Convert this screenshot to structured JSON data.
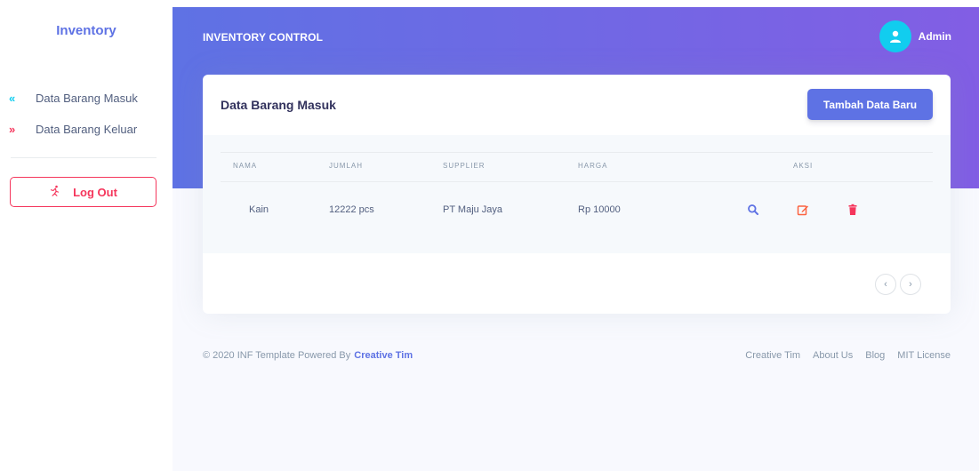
{
  "sidebar": {
    "brand": "Inventory",
    "items": [
      {
        "label": "Data Barang Masuk",
        "icon": "double-chevron-left-icon",
        "glyph": "«",
        "color": "#11cdef"
      },
      {
        "label": "Data Barang Keluar",
        "icon": "double-chevron-right-icon",
        "glyph": "»",
        "color": "#f5365c"
      }
    ],
    "logout_label": "Log Out"
  },
  "header": {
    "title": "INVENTORY CONTROL",
    "user_name": "Admin"
  },
  "card": {
    "title": "Data Barang Masuk",
    "add_button": "Tambah Data Baru",
    "columns": [
      "NAMA",
      "JUMLAH",
      "SUPPLIER",
      "HARGA",
      "AKSI"
    ],
    "rows": [
      {
        "nama": "Kain",
        "jumlah": "12222 pcs",
        "supplier": "PT Maju Jaya",
        "harga": "Rp 10000"
      }
    ],
    "pager": {
      "prev": "‹",
      "next": "›"
    }
  },
  "footer": {
    "copyright": "© 2020 INF Template Powered By",
    "brand_link": "Creative Tim",
    "links": [
      "Creative Tim",
      "About Us",
      "Blog",
      "MIT License"
    ]
  },
  "colors": {
    "primary": "#5e72e4",
    "gradient_end": "#825ee4",
    "info": "#11cdef",
    "danger": "#f5365c",
    "warning": "#fb6340"
  }
}
